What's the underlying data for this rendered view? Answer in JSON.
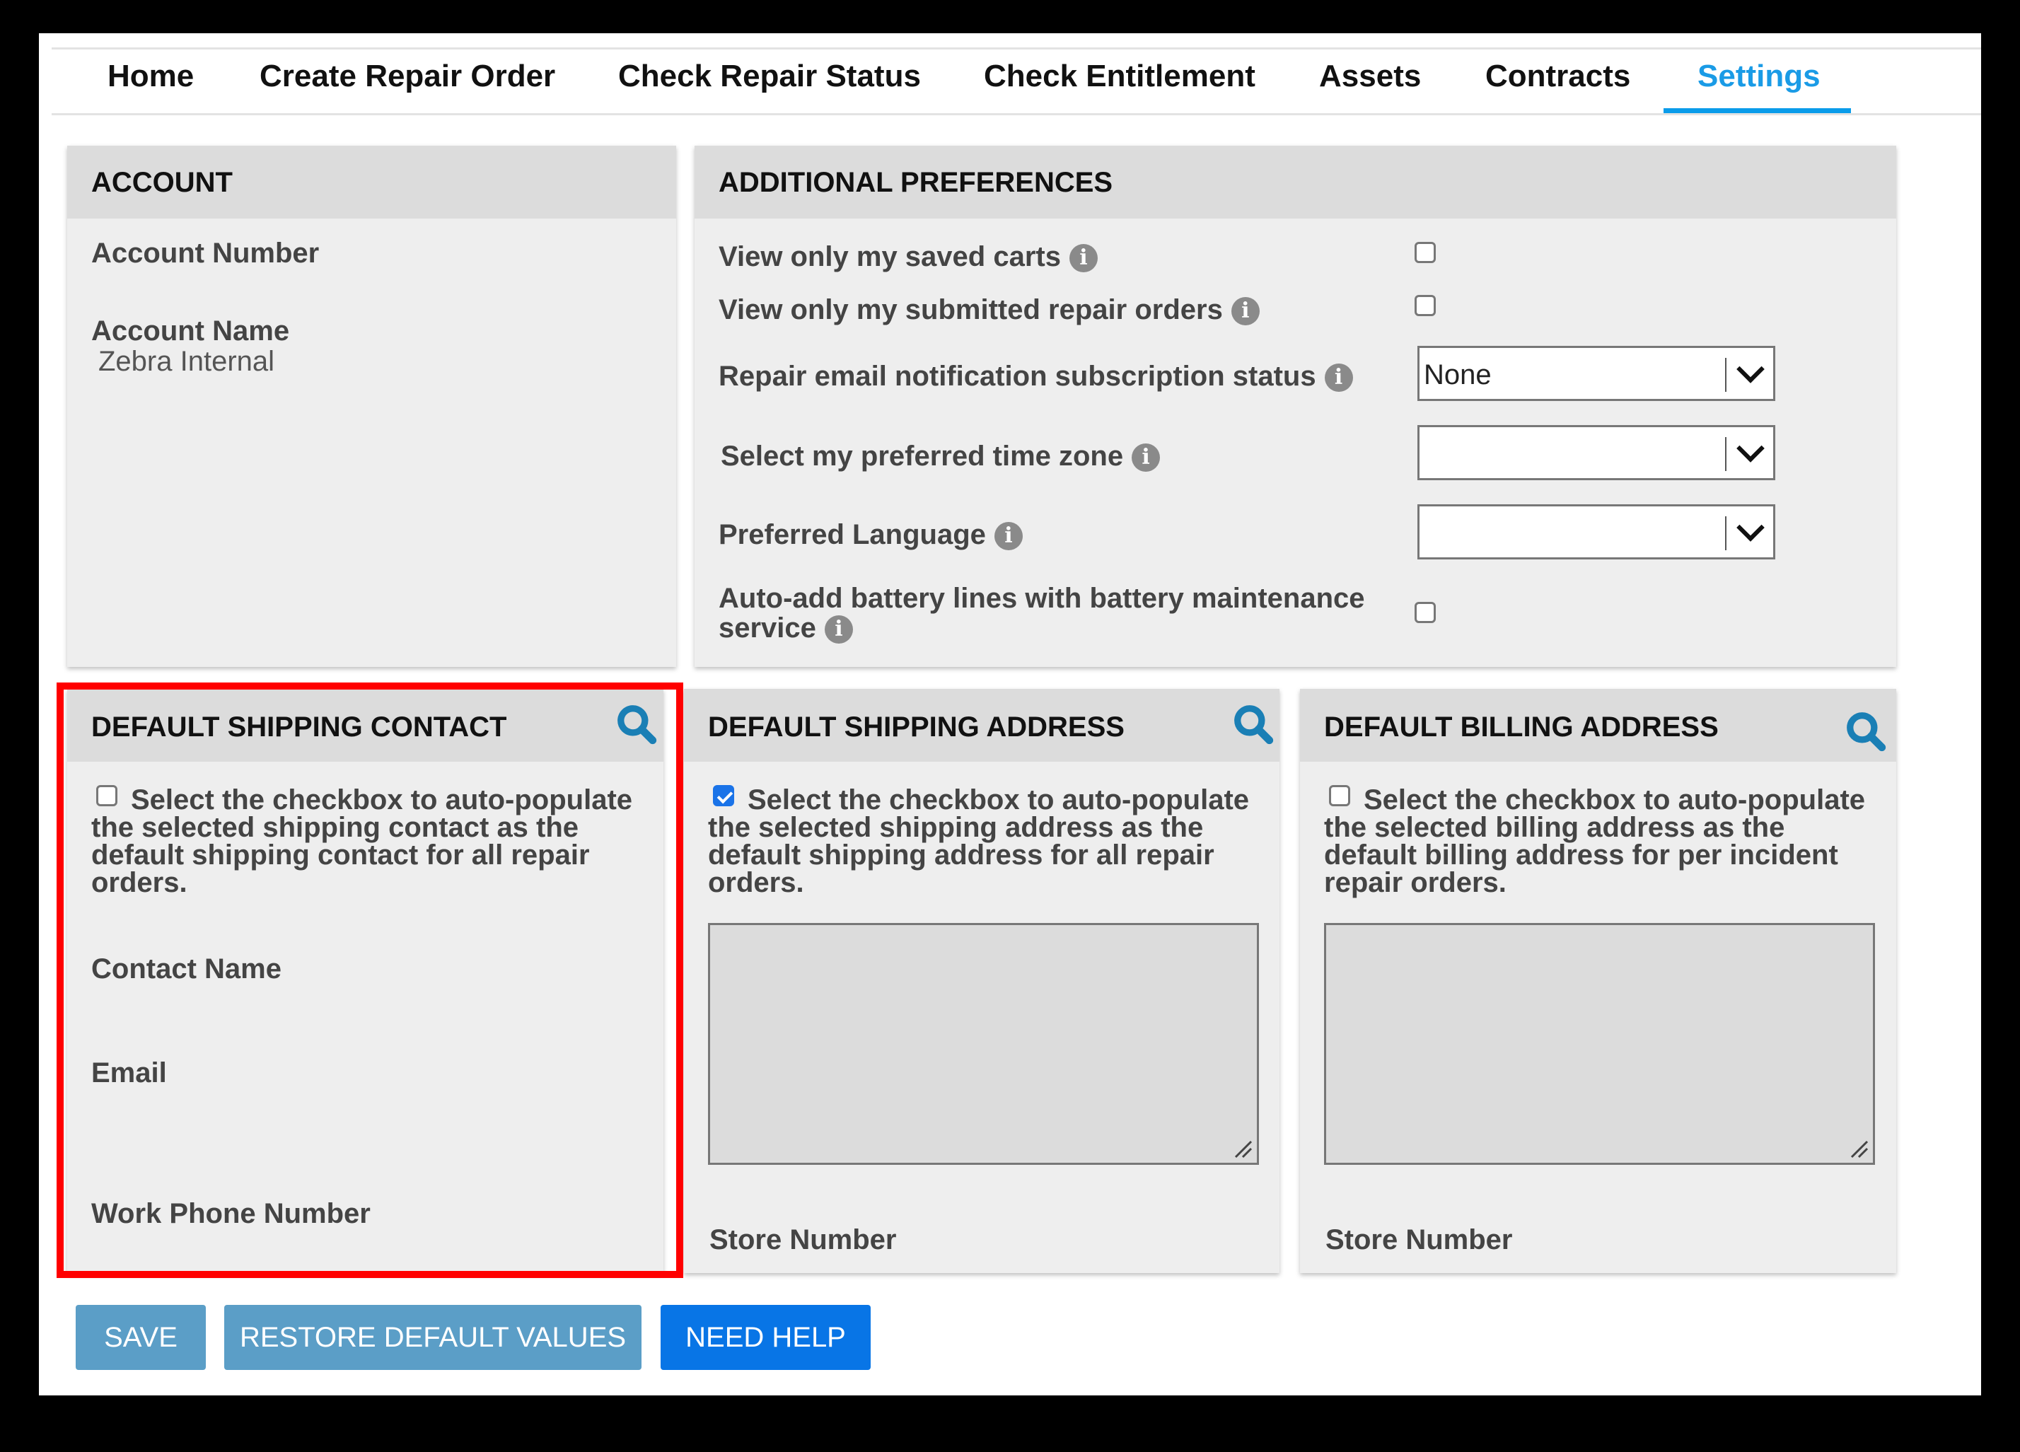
{
  "nav": {
    "items": [
      {
        "label": "Home",
        "active": false
      },
      {
        "label": "Create Repair Order",
        "active": false
      },
      {
        "label": "Check Repair Status",
        "active": false
      },
      {
        "label": "Check Entitlement",
        "active": false
      },
      {
        "label": "Assets",
        "active": false
      },
      {
        "label": "Contracts",
        "active": false
      },
      {
        "label": "Settings",
        "active": true
      }
    ],
    "active_color": "#1a9be6"
  },
  "account": {
    "title": "ACCOUNT",
    "account_number_label": "Account Number",
    "account_number_value": "",
    "account_name_label": "Account Name",
    "account_name_value": "Zebra Internal"
  },
  "preferences": {
    "title": "ADDITIONAL PREFERENCES",
    "info_icon": "i",
    "saved_carts": {
      "label": "View only my saved carts",
      "checked": false
    },
    "submitted_orders": {
      "label": "View only my submitted repair orders",
      "checked": false
    },
    "email_notification": {
      "label": "Repair email notification subscription status",
      "value": "None"
    },
    "time_zone": {
      "label": "Select my preferred time zone",
      "value": ""
    },
    "language": {
      "label": "Preferred Language",
      "value": ""
    },
    "battery": {
      "label_line1": "Auto-add battery lines with battery maintenance",
      "label_line2": "service",
      "checked": false
    }
  },
  "shipping_contact": {
    "title": "DEFAULT SHIPPING CONTACT",
    "checked": false,
    "description_lines": [
      "Select the checkbox to auto-populate",
      "the selected shipping contact as the",
      "default shipping contact for all repair",
      "orders."
    ],
    "contact_name_label": "Contact Name",
    "email_label": "Email",
    "work_phone_label": "Work Phone Number",
    "highlight_color": "#ff0000"
  },
  "shipping_address": {
    "title": "DEFAULT SHIPPING ADDRESS",
    "checked": true,
    "description_lines": [
      "Select the checkbox to auto-populate",
      "the selected shipping address as the",
      "default shipping address for all repair",
      "orders."
    ],
    "address_value": "",
    "store_number_label": "Store Number"
  },
  "billing_address": {
    "title": "DEFAULT BILLING ADDRESS",
    "checked": false,
    "description_lines": [
      "Select the checkbox to auto-populate",
      "the selected billing address as the",
      "default billing address for per incident",
      "repair orders."
    ],
    "address_value": "",
    "store_number_label": "Store Number"
  },
  "buttons": {
    "save": "SAVE",
    "restore": "RESTORE DEFAULT VALUES",
    "help": "NEED HELP"
  },
  "colors": {
    "button_muted": "#5b9ec7",
    "button_primary": "#0875e6",
    "search_icon": "#1a7fb5"
  }
}
